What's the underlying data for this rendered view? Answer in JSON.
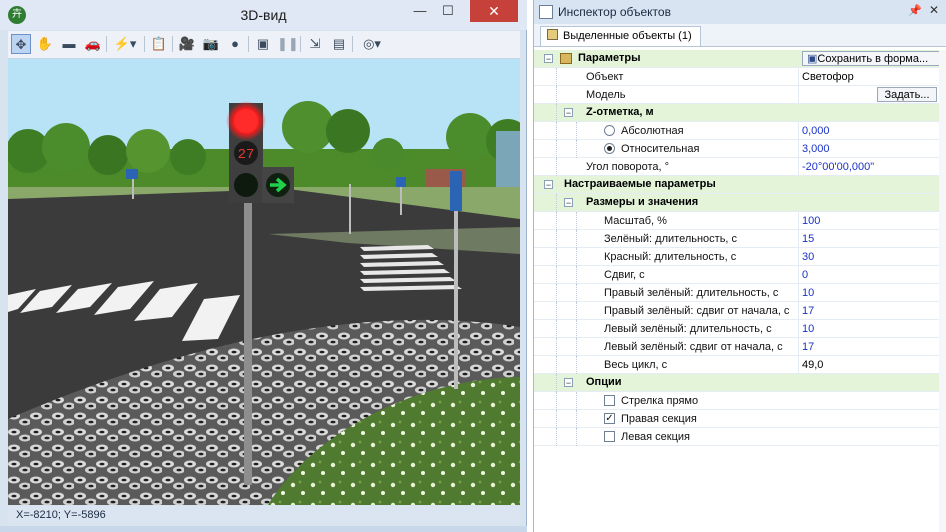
{
  "window3d": {
    "title": "3D-вид",
    "app_icon": "app-logo-icon",
    "controls": {
      "minimize": "—",
      "maximize": "☐",
      "close": "✕"
    },
    "toolbar_icons": [
      "move-icon",
      "hand-pan-icon",
      "camera-fly-icon",
      "car-icon",
      "flash-dropdown-icon",
      "clipboard-icon",
      "camera-record-icon",
      "camera-photo-icon",
      "palette-icon",
      "render-icon",
      "pause-icon",
      "export-icon",
      "save-view-icon",
      "compass-icon"
    ],
    "status": "X=-8210; Y=-5896",
    "traffic_light": {
      "countdown": "27",
      "red": "#ff2a2a",
      "green": "#1fd04a"
    }
  },
  "inspector": {
    "title": "Инспектор объектов",
    "pin": "₰",
    "close": "✕",
    "tab": "Выделенные объекты (1)",
    "rows": {
      "params": "Параметры",
      "save_button": "Сохранить в форма...",
      "object_label": "Объект",
      "object_value": "Светофор",
      "model_label": "Модель",
      "model_button": "Задать...",
      "z_label": "Z-отметка, м",
      "abs_label": "Абсолютная",
      "abs_value": "0,000",
      "rel_label": "Относительная",
      "rel_value": "3,000",
      "rot_label": "Угол поворота, °",
      "rot_value": "-20°00'00,000\"",
      "custom": "Настраиваемые параметры",
      "sizes": "Размеры и значения",
      "scale_label": "Масштаб, %",
      "scale_value": "100",
      "green_label": "Зелёный: длительность, с",
      "green_value": "15",
      "red_label": "Красный: длительность, с",
      "red_value": "30",
      "shift_label": "Сдвиг, с",
      "shift_value": "0",
      "rg_label": "Правый зелёный: длительность, с",
      "rg_value": "10",
      "rgs_label": "Правый зелёный: сдвиг от начала, с",
      "rgs_value": "17",
      "lg_label": "Левый зелёный: длительность, с",
      "lg_value": "10",
      "lgs_label": "Левый зелёный: сдвиг от начала, с",
      "lgs_value": "17",
      "cycle_label": "Весь цикл, с",
      "cycle_value": "49,0",
      "options": "Опции",
      "opt_straight": "Стрелка прямо",
      "opt_right": "Правая секция",
      "opt_left": "Левая секция"
    },
    "radio_selected": "relative",
    "checkboxes": {
      "straight": false,
      "right": true,
      "left": false
    },
    "category_color": "#e3f4d9"
  }
}
